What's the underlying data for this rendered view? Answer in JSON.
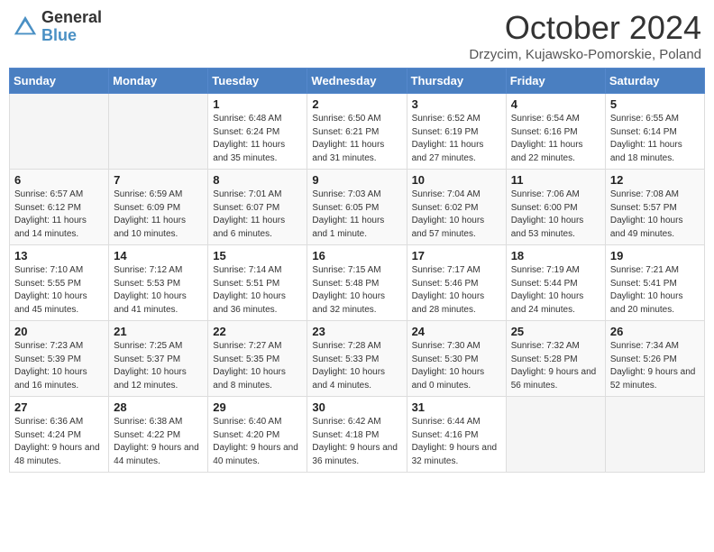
{
  "header": {
    "logo_general": "General",
    "logo_blue": "Blue",
    "month_title": "October 2024",
    "subtitle": "Drzycim, Kujawsko-Pomorskie, Poland"
  },
  "days_of_week": [
    "Sunday",
    "Monday",
    "Tuesday",
    "Wednesday",
    "Thursday",
    "Friday",
    "Saturday"
  ],
  "weeks": [
    [
      {
        "num": "",
        "sunrise": "",
        "sunset": "",
        "daylight": ""
      },
      {
        "num": "",
        "sunrise": "",
        "sunset": "",
        "daylight": ""
      },
      {
        "num": "1",
        "sunrise": "Sunrise: 6:48 AM",
        "sunset": "Sunset: 6:24 PM",
        "daylight": "Daylight: 11 hours and 35 minutes."
      },
      {
        "num": "2",
        "sunrise": "Sunrise: 6:50 AM",
        "sunset": "Sunset: 6:21 PM",
        "daylight": "Daylight: 11 hours and 31 minutes."
      },
      {
        "num": "3",
        "sunrise": "Sunrise: 6:52 AM",
        "sunset": "Sunset: 6:19 PM",
        "daylight": "Daylight: 11 hours and 27 minutes."
      },
      {
        "num": "4",
        "sunrise": "Sunrise: 6:54 AM",
        "sunset": "Sunset: 6:16 PM",
        "daylight": "Daylight: 11 hours and 22 minutes."
      },
      {
        "num": "5",
        "sunrise": "Sunrise: 6:55 AM",
        "sunset": "Sunset: 6:14 PM",
        "daylight": "Daylight: 11 hours and 18 minutes."
      }
    ],
    [
      {
        "num": "6",
        "sunrise": "Sunrise: 6:57 AM",
        "sunset": "Sunset: 6:12 PM",
        "daylight": "Daylight: 11 hours and 14 minutes."
      },
      {
        "num": "7",
        "sunrise": "Sunrise: 6:59 AM",
        "sunset": "Sunset: 6:09 PM",
        "daylight": "Daylight: 11 hours and 10 minutes."
      },
      {
        "num": "8",
        "sunrise": "Sunrise: 7:01 AM",
        "sunset": "Sunset: 6:07 PM",
        "daylight": "Daylight: 11 hours and 6 minutes."
      },
      {
        "num": "9",
        "sunrise": "Sunrise: 7:03 AM",
        "sunset": "Sunset: 6:05 PM",
        "daylight": "Daylight: 11 hours and 1 minute."
      },
      {
        "num": "10",
        "sunrise": "Sunrise: 7:04 AM",
        "sunset": "Sunset: 6:02 PM",
        "daylight": "Daylight: 10 hours and 57 minutes."
      },
      {
        "num": "11",
        "sunrise": "Sunrise: 7:06 AM",
        "sunset": "Sunset: 6:00 PM",
        "daylight": "Daylight: 10 hours and 53 minutes."
      },
      {
        "num": "12",
        "sunrise": "Sunrise: 7:08 AM",
        "sunset": "Sunset: 5:57 PM",
        "daylight": "Daylight: 10 hours and 49 minutes."
      }
    ],
    [
      {
        "num": "13",
        "sunrise": "Sunrise: 7:10 AM",
        "sunset": "Sunset: 5:55 PM",
        "daylight": "Daylight: 10 hours and 45 minutes."
      },
      {
        "num": "14",
        "sunrise": "Sunrise: 7:12 AM",
        "sunset": "Sunset: 5:53 PM",
        "daylight": "Daylight: 10 hours and 41 minutes."
      },
      {
        "num": "15",
        "sunrise": "Sunrise: 7:14 AM",
        "sunset": "Sunset: 5:51 PM",
        "daylight": "Daylight: 10 hours and 36 minutes."
      },
      {
        "num": "16",
        "sunrise": "Sunrise: 7:15 AM",
        "sunset": "Sunset: 5:48 PM",
        "daylight": "Daylight: 10 hours and 32 minutes."
      },
      {
        "num": "17",
        "sunrise": "Sunrise: 7:17 AM",
        "sunset": "Sunset: 5:46 PM",
        "daylight": "Daylight: 10 hours and 28 minutes."
      },
      {
        "num": "18",
        "sunrise": "Sunrise: 7:19 AM",
        "sunset": "Sunset: 5:44 PM",
        "daylight": "Daylight: 10 hours and 24 minutes."
      },
      {
        "num": "19",
        "sunrise": "Sunrise: 7:21 AM",
        "sunset": "Sunset: 5:41 PM",
        "daylight": "Daylight: 10 hours and 20 minutes."
      }
    ],
    [
      {
        "num": "20",
        "sunrise": "Sunrise: 7:23 AM",
        "sunset": "Sunset: 5:39 PM",
        "daylight": "Daylight: 10 hours and 16 minutes."
      },
      {
        "num": "21",
        "sunrise": "Sunrise: 7:25 AM",
        "sunset": "Sunset: 5:37 PM",
        "daylight": "Daylight: 10 hours and 12 minutes."
      },
      {
        "num": "22",
        "sunrise": "Sunrise: 7:27 AM",
        "sunset": "Sunset: 5:35 PM",
        "daylight": "Daylight: 10 hours and 8 minutes."
      },
      {
        "num": "23",
        "sunrise": "Sunrise: 7:28 AM",
        "sunset": "Sunset: 5:33 PM",
        "daylight": "Daylight: 10 hours and 4 minutes."
      },
      {
        "num": "24",
        "sunrise": "Sunrise: 7:30 AM",
        "sunset": "Sunset: 5:30 PM",
        "daylight": "Daylight: 10 hours and 0 minutes."
      },
      {
        "num": "25",
        "sunrise": "Sunrise: 7:32 AM",
        "sunset": "Sunset: 5:28 PM",
        "daylight": "Daylight: 9 hours and 56 minutes."
      },
      {
        "num": "26",
        "sunrise": "Sunrise: 7:34 AM",
        "sunset": "Sunset: 5:26 PM",
        "daylight": "Daylight: 9 hours and 52 minutes."
      }
    ],
    [
      {
        "num": "27",
        "sunrise": "Sunrise: 6:36 AM",
        "sunset": "Sunset: 4:24 PM",
        "daylight": "Daylight: 9 hours and 48 minutes."
      },
      {
        "num": "28",
        "sunrise": "Sunrise: 6:38 AM",
        "sunset": "Sunset: 4:22 PM",
        "daylight": "Daylight: 9 hours and 44 minutes."
      },
      {
        "num": "29",
        "sunrise": "Sunrise: 6:40 AM",
        "sunset": "Sunset: 4:20 PM",
        "daylight": "Daylight: 9 hours and 40 minutes."
      },
      {
        "num": "30",
        "sunrise": "Sunrise: 6:42 AM",
        "sunset": "Sunset: 4:18 PM",
        "daylight": "Daylight: 9 hours and 36 minutes."
      },
      {
        "num": "31",
        "sunrise": "Sunrise: 6:44 AM",
        "sunset": "Sunset: 4:16 PM",
        "daylight": "Daylight: 9 hours and 32 minutes."
      },
      {
        "num": "",
        "sunrise": "",
        "sunset": "",
        "daylight": ""
      },
      {
        "num": "",
        "sunrise": "",
        "sunset": "",
        "daylight": ""
      }
    ]
  ]
}
